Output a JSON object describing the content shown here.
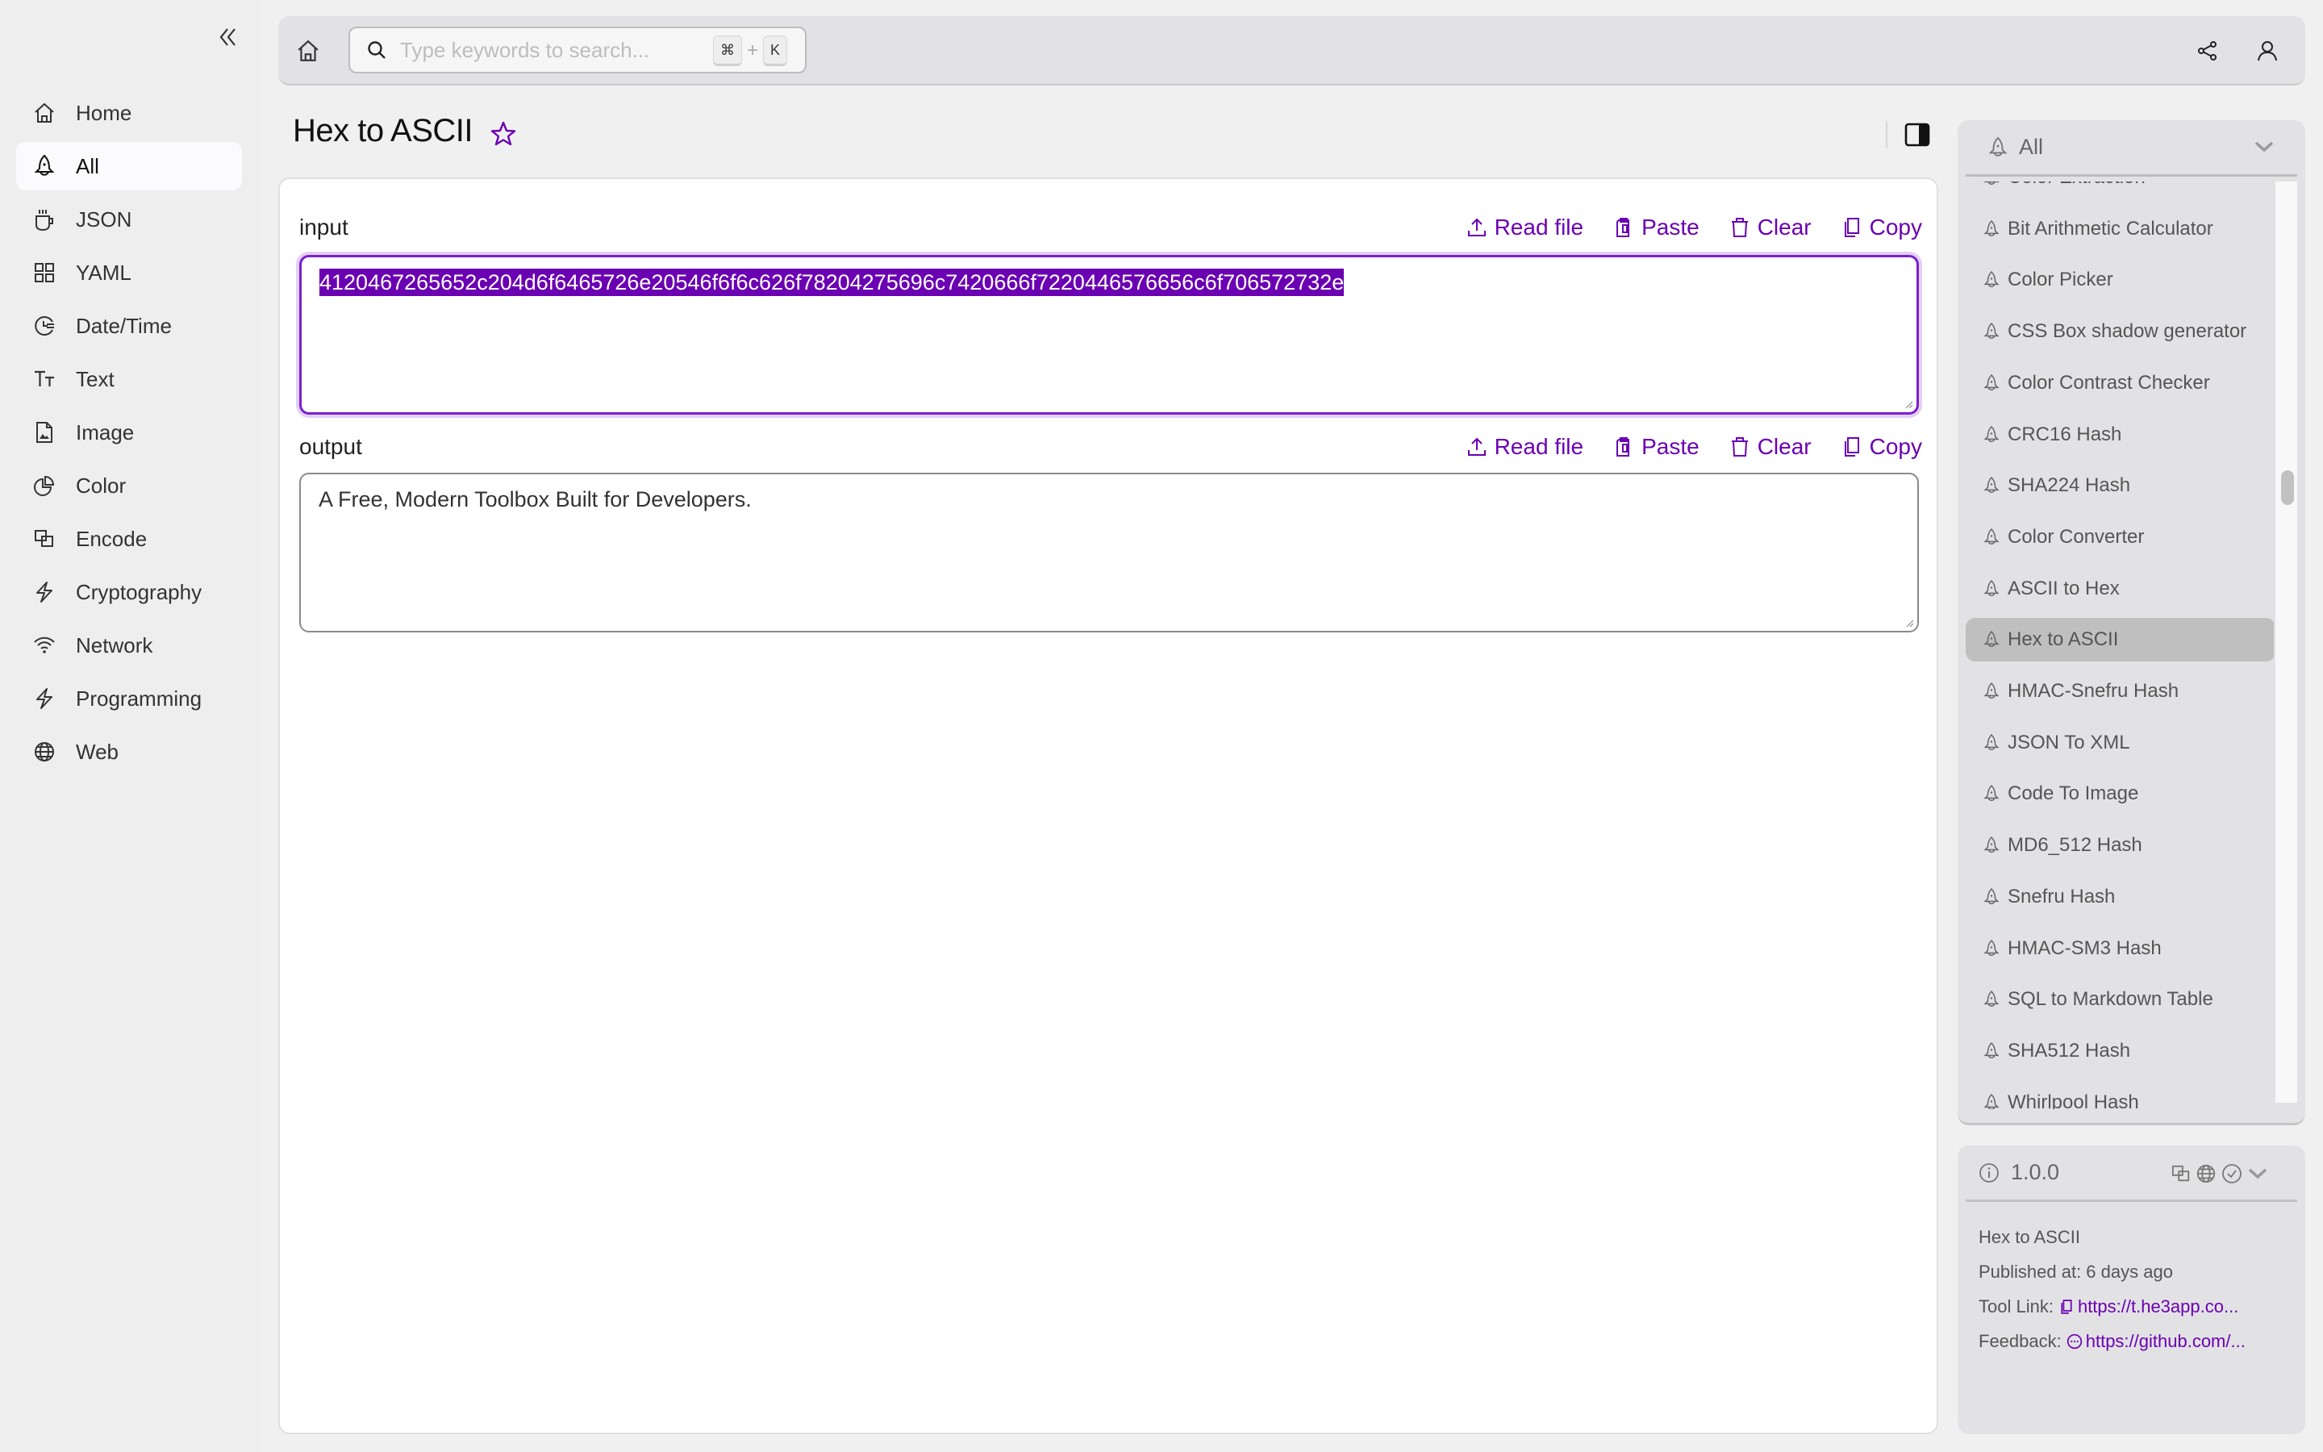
{
  "sidebar": {
    "collapse_icon": "double-chevron-left-icon",
    "items": [
      {
        "label": "Home",
        "icon": "home-icon",
        "active": false
      },
      {
        "label": "All",
        "icon": "rocket-icon",
        "active": true
      },
      {
        "label": "JSON",
        "icon": "cup-icon",
        "active": false
      },
      {
        "label": "YAML",
        "icon": "grid-icon",
        "active": false
      },
      {
        "label": "Date/Time",
        "icon": "clock-icon",
        "active": false
      },
      {
        "label": "Text",
        "icon": "text-size-icon",
        "active": false
      },
      {
        "label": "Image",
        "icon": "image-icon",
        "active": false
      },
      {
        "label": "Color",
        "icon": "pie-icon",
        "active": false
      },
      {
        "label": "Encode",
        "icon": "encode-icon",
        "active": false
      },
      {
        "label": "Cryptography",
        "icon": "bolt-icon",
        "active": false
      },
      {
        "label": "Network",
        "icon": "wifi-icon",
        "active": false
      },
      {
        "label": "Programming",
        "icon": "bolt-icon",
        "active": false
      },
      {
        "label": "Web",
        "icon": "globe-icon",
        "active": false
      }
    ]
  },
  "topbar": {
    "search_placeholder": "Type keywords to search...",
    "search_value": "",
    "shortcut_mod": "⌘",
    "shortcut_plus": "+",
    "shortcut_key": "K"
  },
  "page": {
    "title": "Hex to ASCII"
  },
  "input": {
    "label": "input",
    "value": "4120467265652c204d6f6465726e20546f6f6c626f78204275696c7420666f7220446576656c6f706572732e",
    "actions": [
      "Read file",
      "Paste",
      "Clear",
      "Copy"
    ]
  },
  "output": {
    "label": "output",
    "value": "A Free, Modern Toolbox Built for Developers.",
    "actions": [
      "Read file",
      "Paste",
      "Clear",
      "Copy"
    ]
  },
  "tool_list": {
    "category": "All",
    "items": [
      {
        "label": "Color Extraction",
        "active": false
      },
      {
        "label": "Bit Arithmetic Calculator",
        "active": false
      },
      {
        "label": "Color Picker",
        "active": false
      },
      {
        "label": "CSS Box shadow generator",
        "active": false
      },
      {
        "label": "Color Contrast Checker",
        "active": false
      },
      {
        "label": "CRC16 Hash",
        "active": false
      },
      {
        "label": "SHA224 Hash",
        "active": false
      },
      {
        "label": "Color Converter",
        "active": false
      },
      {
        "label": "ASCII to Hex",
        "active": false
      },
      {
        "label": "Hex to ASCII",
        "active": true
      },
      {
        "label": "HMAC-Snefru Hash",
        "active": false
      },
      {
        "label": "JSON To XML",
        "active": false
      },
      {
        "label": "Code To Image",
        "active": false
      },
      {
        "label": "MD6_512 Hash",
        "active": false
      },
      {
        "label": "Snefru Hash",
        "active": false
      },
      {
        "label": "HMAC-SM3 Hash",
        "active": false
      },
      {
        "label": "SQL to Markdown Table",
        "active": false
      },
      {
        "label": "SHA512 Hash",
        "active": false
      },
      {
        "label": "Whirlpool Hash",
        "active": false
      }
    ]
  },
  "info": {
    "version": "1.0.0",
    "tool_name": "Hex to ASCII",
    "published": "Published at: 6 days ago",
    "tool_link_label": "Tool Link:",
    "tool_link": "https://t.he3app.co...",
    "feedback_label": "Feedback:",
    "feedback_link": "https://github.com/..."
  },
  "colors": {
    "accent": "#6b00b3",
    "selection_bg": "#6b00b3",
    "active_list_bg": "#bfbfbf"
  }
}
